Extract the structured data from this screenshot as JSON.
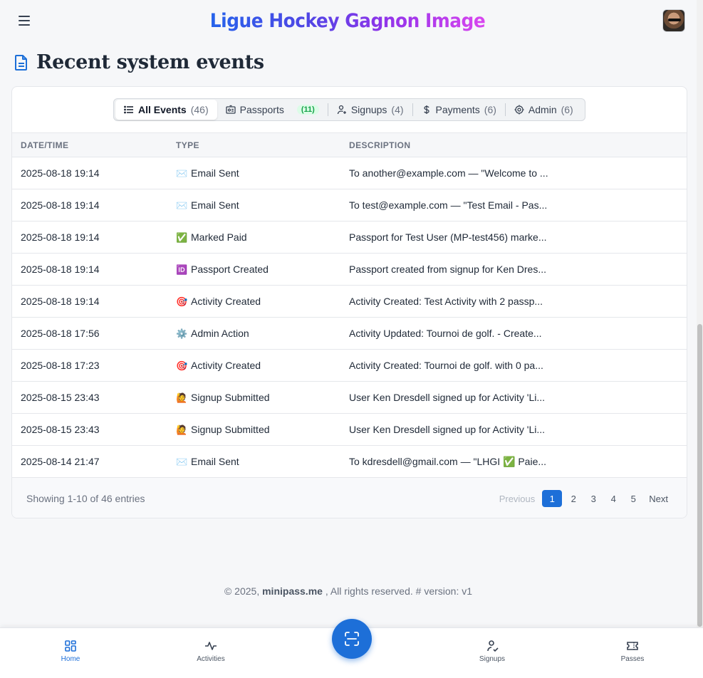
{
  "app": {
    "brand": "Ligue Hockey Gagnon Image"
  },
  "page": {
    "title": "Recent system events"
  },
  "filters": [
    {
      "label": "All Events",
      "count": "(46)",
      "icon": "list-icon",
      "active": true
    },
    {
      "label": "Passports",
      "count": "(11)",
      "icon": "id-card-icon"
    },
    {
      "label": "Signups",
      "count": "(4)",
      "icon": "user-plus-icon"
    },
    {
      "label": "Payments",
      "count": "(6)",
      "icon": "dollar-icon"
    },
    {
      "label": "Admin",
      "count": "(6)",
      "icon": "gear-icon"
    }
  ],
  "table": {
    "headers": [
      "DATE/TIME",
      "TYPE",
      "DESCRIPTION"
    ],
    "rows": [
      {
        "date": "2025-08-18 19:14",
        "icon": "✉️",
        "type": "Email Sent",
        "desc": "To another@example.com — \"Welcome to ..."
      },
      {
        "date": "2025-08-18 19:14",
        "icon": "✉️",
        "type": "Email Sent",
        "desc": "To test@example.com — \"Test Email - Pas..."
      },
      {
        "date": "2025-08-18 19:14",
        "icon": "✅",
        "type": "Marked Paid",
        "desc": "Passport for Test User (MP-test456) marke..."
      },
      {
        "date": "2025-08-18 19:14",
        "icon": "🆔",
        "type": "Passport Created",
        "desc": "Passport created from signup for Ken Dres..."
      },
      {
        "date": "2025-08-18 19:14",
        "icon": "🎯",
        "type": "Activity Created",
        "desc": "Activity Created: Test Activity with 2 passp..."
      },
      {
        "date": "2025-08-18 17:56",
        "icon": "⚙️",
        "type": "Admin Action",
        "desc": "Activity Updated: Tournoi de golf. - Create..."
      },
      {
        "date": "2025-08-18 17:23",
        "icon": "🎯",
        "type": "Activity Created",
        "desc": "Activity Created: Tournoi de golf. with 0 pa..."
      },
      {
        "date": "2025-08-15 23:43",
        "icon": "🙋",
        "type": "Signup Submitted",
        "desc": "User Ken Dresdell signed up for Activity 'Li..."
      },
      {
        "date": "2025-08-15 23:43",
        "icon": "🙋",
        "type": "Signup Submitted",
        "desc": "User Ken Dresdell signed up for Activity 'Li..."
      },
      {
        "date": "2025-08-14 21:47",
        "icon": "✉️",
        "type": "Email Sent",
        "desc": "To kdresdell@gmail.com — \"LHGI ✅ Paie..."
      }
    ]
  },
  "pagination": {
    "showing": "Showing 1-10 of 46 entries",
    "previous": "Previous",
    "next": "Next",
    "pages": [
      "1",
      "2",
      "3",
      "4",
      "5"
    ],
    "current": "1"
  },
  "footer": {
    "prefix": "© 2025,",
    "site": "minipass.me",
    "suffix": ", All rights reserved. # version: v1"
  },
  "bottom_nav": [
    {
      "label": "Home",
      "icon": "grid-icon",
      "active": true
    },
    {
      "label": "Activities",
      "icon": "activity-icon"
    },
    {
      "label": "Signups",
      "icon": "user-check-icon"
    },
    {
      "label": "Passes",
      "icon": "ticket-icon"
    }
  ],
  "colors": {
    "accent": "#1d6fd8",
    "badge_green": "#16a34a"
  }
}
